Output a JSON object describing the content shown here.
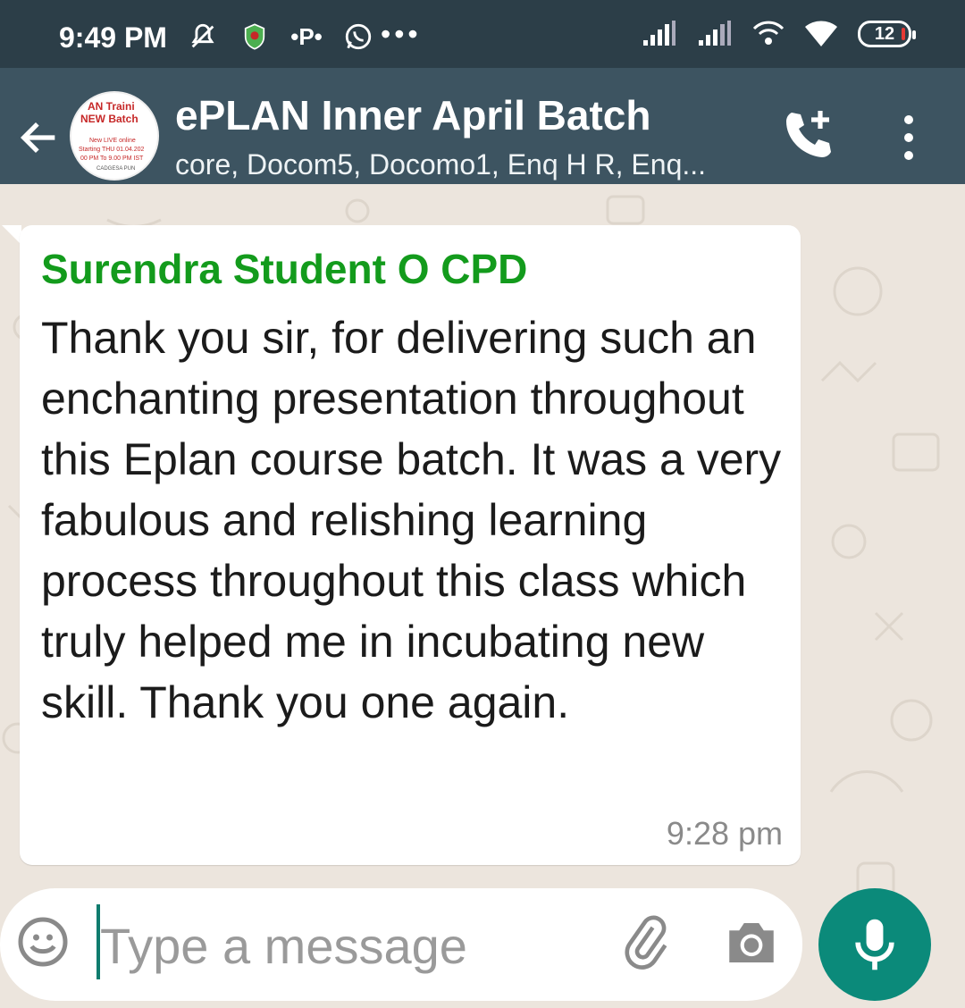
{
  "status_bar": {
    "time": "9:49 PM",
    "battery_level": "12",
    "icons": [
      "mute-icon",
      "shield-icon",
      "p-icon",
      "whatsapp-icon",
      "more-dots-icon",
      "signal-icon",
      "signal-icon-2",
      "wifi-call-icon",
      "wifi-icon",
      "battery-icon"
    ]
  },
  "header": {
    "title": "ePLAN Inner April Batch",
    "subtitle": "core, Docom5, Docomo1, Enq H R, Enq...",
    "avatar_lines": [
      "AN Traini",
      "NEW Batch",
      "New LIVE online",
      "Starting THU 01.04.202",
      "00 PM To 9.00 PM IST",
      "CADGESA PUN"
    ]
  },
  "messages": [
    {
      "sender": "Surendra Student O CPD",
      "text": "Thank you sir, for delivering such an enchanting presentation throughout this Eplan course batch. It was a very fabulous and relishing learning process throughout this class which truly helped me in incubating new skill. Thank you one again.",
      "time": "9:28 pm"
    }
  ],
  "input": {
    "placeholder": "Type a message"
  },
  "colors": {
    "status_bar_bg": "#2c3e48",
    "header_bg": "#3d5461",
    "sender_name": "#139b1c",
    "mic_button": "#0b8a7a",
    "chat_bg": "#ece5dd"
  }
}
